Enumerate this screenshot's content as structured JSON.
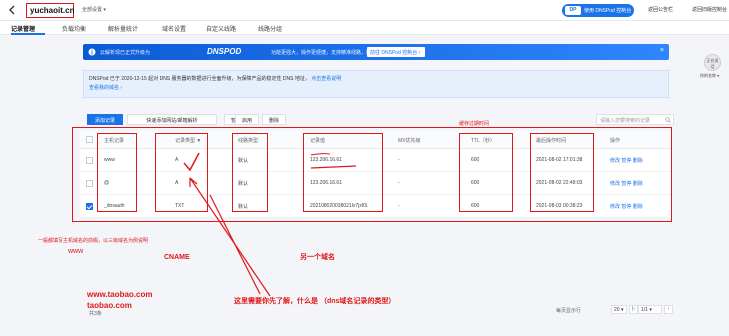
{
  "header": {
    "domain": "yuchaoit.cn",
    "status": "全部设置 ▾",
    "dnspod_button": "使用 DNSPod 控制台",
    "link_right1": "返回公告栏",
    "link_right2": "返回旧版控制台"
  },
  "tabs": [
    "记录管理",
    "负载均衡",
    "解析量统计",
    "域名设置",
    "自定义线路",
    "线路分组"
  ],
  "banner": {
    "text": "云解析现已正式升级为",
    "logo": "DNSPOD",
    "desc": "功能更强大，操作更便捷，支持精准线路，控制台升级",
    "button": "前往 DNSPod 控制台 ›"
  },
  "notice": {
    "line1": "DNSPod 已于 2020-12-15 起对 DNS 服务器的数据进行全面升级，为保障产品的稳定性 DNS 地址，",
    "line1_link": "点击查看说明",
    "line2": "查看我的域名 ›"
  },
  "toolbar": {
    "add": "添加记录",
    "quick": "快速添加网站/邮箱解析",
    "pause": "暂停",
    "enable": "启用",
    "delete": "删除",
    "search_placeholder": "请输入您要搜索的记录"
  },
  "table": {
    "headers": [
      "主机记录",
      "记录类型 ▼",
      "线路类型",
      "记录值",
      "MX优先级",
      "TTL（秒）",
      "最后操作时间",
      "操作"
    ],
    "rows": [
      {
        "host": "www",
        "type": "A",
        "line": "默认",
        "value": "123.206.16.61",
        "mx": "-",
        "ttl": "600",
        "time": "2021-08-02 17:01:38",
        "ops": "修改  暂停  删除"
      },
      {
        "host": "@",
        "type": "A",
        "line": "默认",
        "value": "123.206.16.61",
        "mx": "-",
        "ttl": "600",
        "time": "2021-08-02 22:48:03",
        "ops": "修改  暂停  删除"
      },
      {
        "host": "_dnsauth",
        "type": "TXT",
        "line": "默认",
        "value": "202108020038021lv7jxf0l...",
        "mx": "-",
        "ttl": "600",
        "time": "2021-08-03 00:38:23",
        "ops": "修改  暂停  删除"
      }
    ]
  },
  "annotations": {
    "ttl_note": "缓存过期时间",
    "host_note": "一般都填写主机域名的前缀，以三级域名为例说明",
    "www": "www",
    "cname": "CNAME",
    "another": "另一个域名",
    "type_note": "这里需要你先了解，什么是 （dns域名记录的类型）",
    "url1": "www.taobao.com",
    "url2": "taobao.com"
  },
  "pager": {
    "total": "共3条",
    "label": "每页显示行",
    "size": "20 ▾",
    "page": "1/1 ▾"
  },
  "webcam": {
    "text": "正在说话",
    "sub": "你的名称 ▾"
  },
  "colors": {
    "accent": "#1a73e8",
    "annotation": "#e0181b"
  }
}
